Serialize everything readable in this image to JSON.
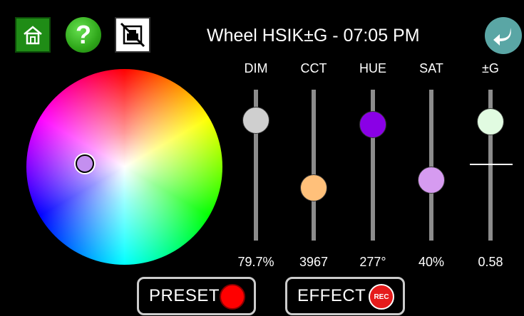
{
  "header": {
    "title": "Wheel HSIK±G - 07:05 PM",
    "home_icon": "home-icon",
    "help_icon": "help-icon",
    "help_glyph": "?",
    "network_icon": "network-disconnected-icon",
    "back_icon": "back-arrow-icon"
  },
  "wheel": {
    "selected_color": "#c48ff0"
  },
  "sliders": [
    {
      "label": "DIM",
      "value": "79.7%",
      "knob_color": "#cfcfcf",
      "level": 0.797
    },
    {
      "label": "CCT",
      "value": "3967",
      "knob_color": "#ffc07a",
      "level": 0.35
    },
    {
      "label": "HUE",
      "value": "277°",
      "knob_color": "#8a00e6",
      "level": 0.77
    },
    {
      "label": "SAT",
      "value": "40%",
      "knob_color": "#d69bf0",
      "level": 0.4
    },
    {
      "label": "±G",
      "value": "0.58",
      "knob_color": "#e1fbe1",
      "level": 0.79
    }
  ],
  "buttons": {
    "preset_label": "PRESET",
    "effect_label": "EFFECT",
    "rec_label": "REC"
  }
}
